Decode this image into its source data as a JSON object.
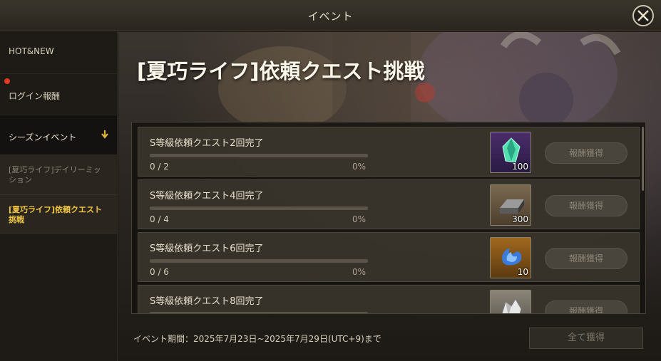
{
  "header": {
    "title": "イベント"
  },
  "sidebar": {
    "items": [
      {
        "label": "HOT&NEW"
      },
      {
        "label": "ログイン報酬",
        "has_notification": true
      },
      {
        "label": "シーズンイベント",
        "expanded": true
      }
    ],
    "sub_items": [
      {
        "label": "[夏巧ライフ]デイリーミッション"
      },
      {
        "label": "[夏巧ライフ]依頼クエスト挑戦",
        "selected": true
      }
    ]
  },
  "main": {
    "title": "[夏巧ライフ]依頼クエスト挑戦",
    "quests": [
      {
        "name": "S等級依頼クエスト2回完了",
        "count": "0 / 2",
        "percent": "0%",
        "progress": 0,
        "reward_icon": "green-crystal-icon",
        "reward_qty": "100",
        "claim_label": "報酬獲得"
      },
      {
        "name": "S等級依頼クエスト4回完了",
        "count": "0 / 4",
        "percent": "0%",
        "progress": 0,
        "reward_icon": "iron-ingot-icon",
        "reward_qty": "300",
        "claim_label": "報酬獲得"
      },
      {
        "name": "S等級依頼クエスト6回完了",
        "count": "0 / 6",
        "percent": "0%",
        "progress": 0,
        "reward_icon": "blue-flame-icon",
        "reward_qty": "10",
        "claim_label": "報酬獲得"
      },
      {
        "name": "S等級依頼クエスト8回完了",
        "count": "",
        "percent": "",
        "progress": 0,
        "reward_icon": "silver-ore-icon",
        "reward_qty": "",
        "claim_label": "報酬獲得"
      }
    ],
    "period": "イベント期間：2025年7月23日~2025年7月29日(UTC+9)まで",
    "claim_all_label": "全て獲得"
  },
  "colors": {
    "accent": "#f0c642",
    "notification": "#e23a22",
    "progress": "#c9a54a"
  }
}
